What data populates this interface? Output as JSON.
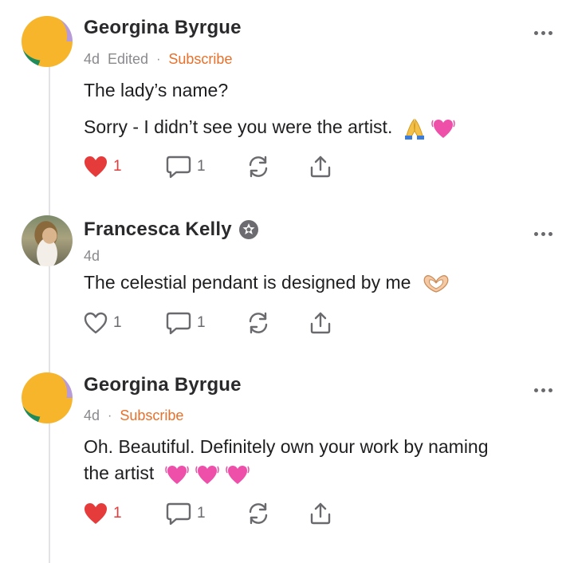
{
  "comments": [
    {
      "name": "Georgina Byrgue",
      "time": "4d",
      "edited": "Edited",
      "subscribe": "Subscribe",
      "body": [
        "The lady’s name?",
        "Sorry - I didn’t see you were the artist."
      ],
      "emojis": [
        "folded-hands-emoji",
        "pink-heart-emoji"
      ],
      "likes": "1",
      "liked": true,
      "replies": "1"
    },
    {
      "name": "Francesca Kelly",
      "badge": "author-badge-icon",
      "time": "4d",
      "body": [
        "The celestial pendant is designed by me"
      ],
      "emojis": [
        "heart-hands-emoji"
      ],
      "likes": "1",
      "liked": false,
      "replies": "1"
    },
    {
      "name": "Georgina Byrgue",
      "time": "4d",
      "subscribe": "Subscribe",
      "body": [
        "Oh. Beautiful. Definitely own your work by naming",
        "the artist"
      ],
      "emojis": [
        "pink-heart-emoji",
        "pink-heart-emoji",
        "pink-heart-emoji"
      ],
      "likes": "1",
      "liked": true,
      "replies": "1"
    }
  ],
  "colors": {
    "like_red": "#e63b3b",
    "subscribe_orange": "#e8702a",
    "muted": "#8a8a8e"
  }
}
